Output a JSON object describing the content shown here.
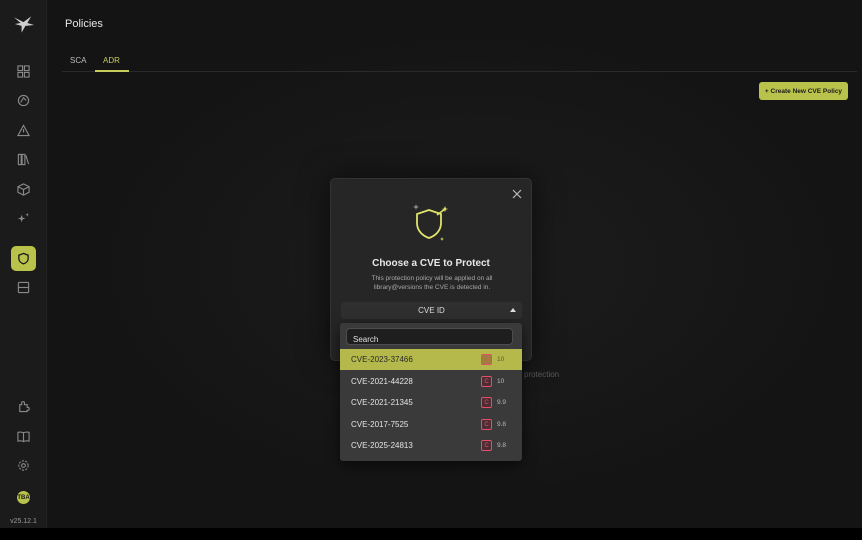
{
  "header": {
    "title": "Policies"
  },
  "tabs": [
    {
      "label": "SCA"
    },
    {
      "label": "ADR"
    }
  ],
  "actions": {
    "create_label": "+ Create New CVE Policy"
  },
  "background": {
    "partial_text": "l protection"
  },
  "sidebar": {
    "icons": [
      "dashboard-icon",
      "inventory-icon",
      "alert-icon",
      "library-icon",
      "package-icon",
      "ai-icon",
      "shield-icon",
      "list-icon",
      "plugin-icon",
      "docs-icon",
      "gear-icon"
    ],
    "avatar_initials": "TBA",
    "version": "v25.12.1"
  },
  "modal": {
    "title": "Choose a CVE to Protect",
    "description": "This protection policy will be applied on all library@versions the CVE is detected in.",
    "select_label": "CVE ID"
  },
  "dropdown": {
    "search_placeholder": "Search",
    "options": [
      {
        "id": "CVE-2023-37466",
        "severity": "C",
        "score": "10"
      },
      {
        "id": "CVE-2021-44228",
        "severity": "C",
        "score": "10"
      },
      {
        "id": "CVE-2021-21345",
        "severity": "C",
        "score": "9.9"
      },
      {
        "id": "CVE-2017-7525",
        "severity": "C",
        "score": "9.8"
      },
      {
        "id": "CVE-2025-24813",
        "severity": "C",
        "score": "9.8"
      }
    ]
  },
  "colors": {
    "accent": "#b9c24a",
    "critical": "#e0506a"
  }
}
